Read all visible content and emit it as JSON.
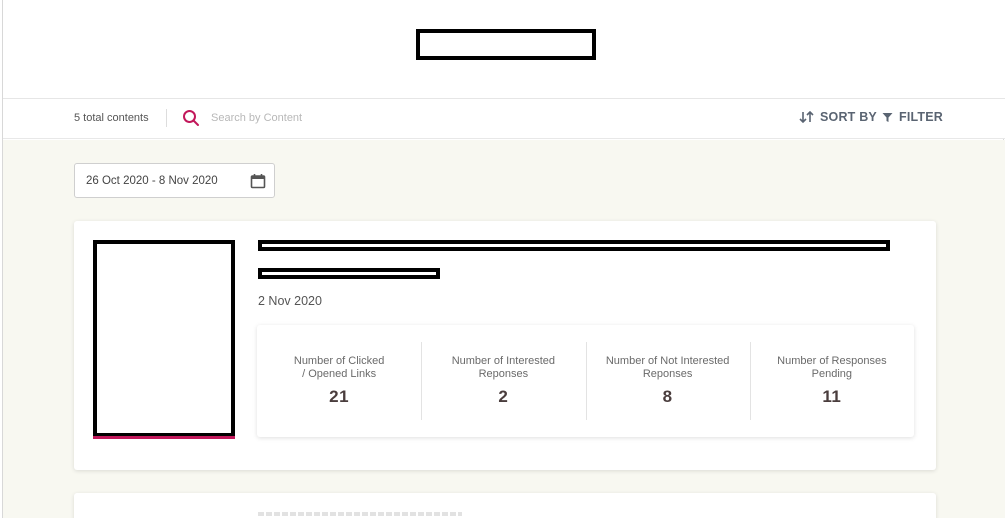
{
  "toolbar": {
    "count_label": "5 total contents",
    "search_placeholder": "Search by Content",
    "sort_label": "SORT BY",
    "filter_label": "FILTER"
  },
  "date_range": {
    "value": "26 Oct 2020 - 8 Nov 2020"
  },
  "content_card": {
    "date": "2 Nov 2020",
    "stats": [
      {
        "label": "Number of Clicked\n/ Opened Links",
        "value": "21"
      },
      {
        "label": "Number of Interested\nReponses",
        "value": "2"
      },
      {
        "label": "Number of Not Interested\nReponses",
        "value": "8"
      },
      {
        "label": "Number of Responses\nPending",
        "value": "11"
      }
    ]
  },
  "colors": {
    "accent": "#c2185b",
    "background": "#f8f8f1",
    "toolbar_text": "#5a6472"
  }
}
